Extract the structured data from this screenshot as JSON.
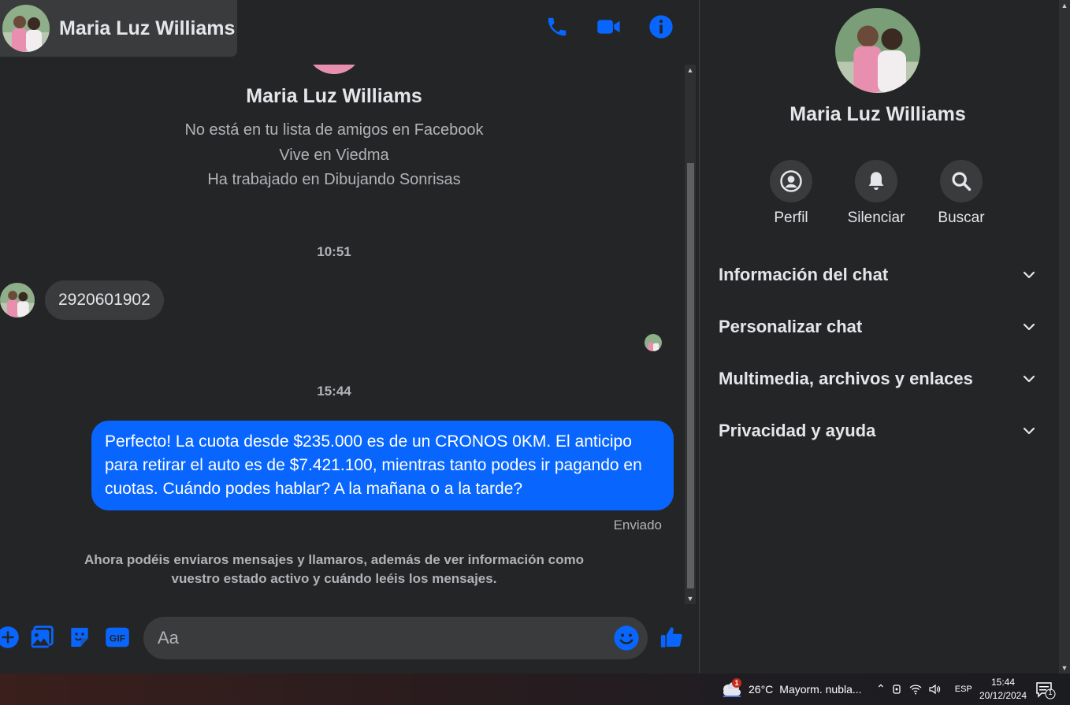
{
  "contact": {
    "name": "Maria Luz Williams"
  },
  "header": {
    "call_icon": "phone-icon",
    "video_icon": "video-camera-icon",
    "info_icon": "info-icon"
  },
  "intro": {
    "name": "Maria Luz Williams",
    "lines": [
      "No está en tu lista de amigos en Facebook",
      "Vive en Viedma",
      "Ha trabajado en Dibujando Sonrisas"
    ]
  },
  "conversation": {
    "time_1": "10:51",
    "incoming_message": "2920601902",
    "time_2": "15:44",
    "outgoing_message": "Perfecto! La cuota desde $235.000 es de un CRONOS 0KM. El anticipo para retirar el auto es de $7.421.100, mientras tanto podes ir pagando en cuotas. Cuándo podes hablar? A la mañana o a la tarde?",
    "sent_status": "Enviado",
    "system_note": "Ahora podéis enviaros mensajes y llamaros, además de ver información como vuestro estado activo y cuándo leéis los mensajes."
  },
  "composer": {
    "placeholder": "Aa",
    "icons": [
      "plus-icon",
      "photo-icon",
      "sticker-icon",
      "gif-icon",
      "emoji-icon",
      "like-icon"
    ]
  },
  "info_panel": {
    "name": "Maria Luz Williams",
    "actions": [
      {
        "label": "Perfil",
        "icon": "profile-icon"
      },
      {
        "label": "Silenciar",
        "icon": "bell-icon"
      },
      {
        "label": "Buscar",
        "icon": "search-icon"
      }
    ],
    "sections": [
      "Información del chat",
      "Personalizar chat",
      "Multimedia, archivos y enlaces",
      "Privacidad y ayuda"
    ]
  },
  "taskbar": {
    "weather_temp": "26°C",
    "weather_desc": "Mayorm. nubla...",
    "weather_badge": "1",
    "language": "ESP",
    "time": "15:44",
    "date": "20/12/2024",
    "notification_count": "1"
  },
  "colors": {
    "accent": "#0866ff",
    "background": "#242526",
    "bubble_in": "#3a3b3c"
  }
}
